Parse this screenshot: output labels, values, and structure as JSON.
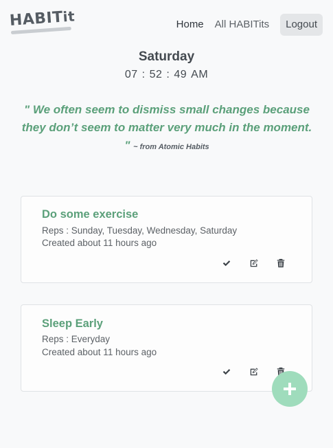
{
  "app": {
    "logo_main": "HABIT",
    "logo_suffix": "it"
  },
  "nav": {
    "home": "Home",
    "all_habits": "All HABITits",
    "logout": "Logout"
  },
  "clock": {
    "day": "Saturday",
    "hours": "07",
    "minutes": "52",
    "seconds": "49",
    "sep1": ":",
    "sep2": ":",
    "meridiem": "AM"
  },
  "quote": {
    "text": "\" We often seem to dismiss small changes because they don’t seem to matter very much in the moment. \"",
    "source": "~ from Atomic Habits"
  },
  "habits": [
    {
      "title": "Do some exercise",
      "reps": "Reps : Sunday, Tuesday, Wednesday, Saturday",
      "created": "Created about 11 hours ago"
    },
    {
      "title": "Sleep Early",
      "reps": "Reps : Everyday",
      "created": "Created about 11 hours ago"
    }
  ],
  "icons": {
    "complete": "check-icon",
    "edit": "edit-icon",
    "delete": "trash-icon",
    "add": "plus-icon"
  },
  "colors": {
    "accent": "#5ba07a",
    "fab": "#9fdcbc",
    "background": "#f8f9fa"
  }
}
